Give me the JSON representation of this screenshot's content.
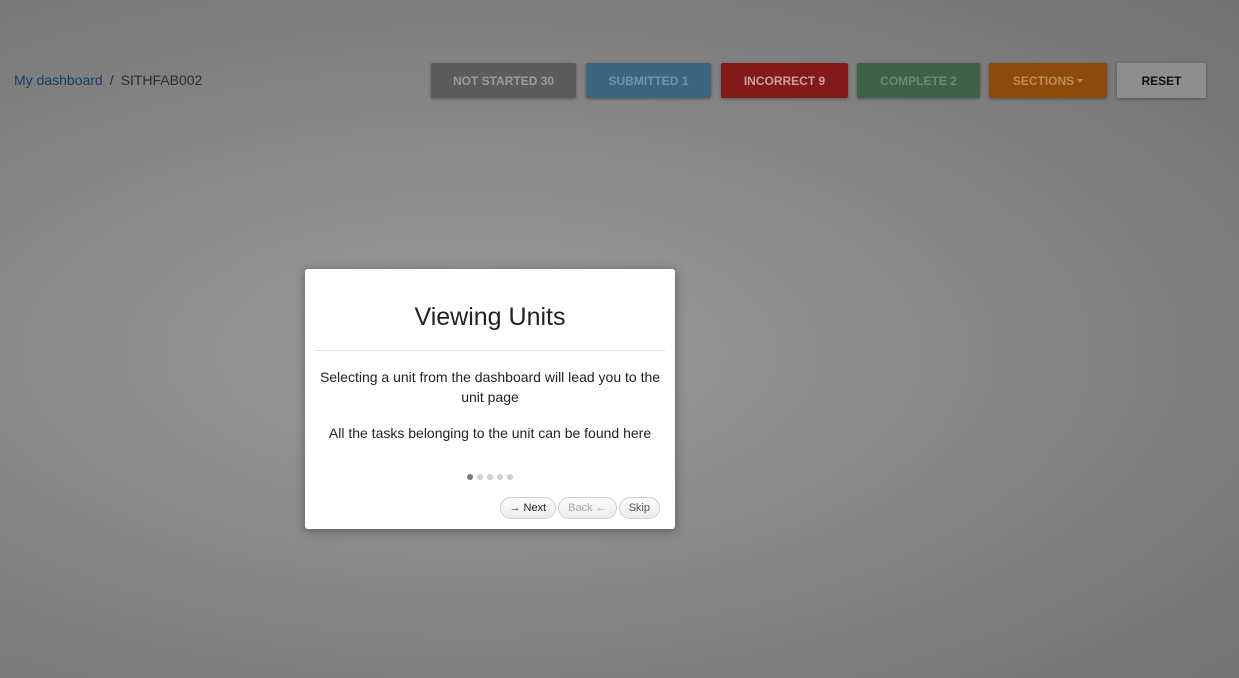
{
  "breadcrumb": {
    "home_label": "My dashboard",
    "separator": "/",
    "current": "SITHFAB002"
  },
  "status_buttons": {
    "not_started": "NOT STARTED 30",
    "submitted": "SUBMITTED 1",
    "incorrect": "INCORRECT 9",
    "complete": "COMPLETE 2",
    "sections": "SECTIONS",
    "reset": "RESET"
  },
  "colors": {
    "not_started": "#5c5c5c",
    "submitted": "#3e6580",
    "incorrect": "#831919",
    "complete": "#3f6148",
    "sections": "#8b4b0b"
  },
  "tour": {
    "title": "Viewing Units",
    "paragraphs": [
      "Selecting a unit from the dashboard will lead you to the unit page",
      "All the tasks belonging to the unit can be found here"
    ],
    "step_current": 1,
    "step_total": 5,
    "next_arrow": "→",
    "next_label": "Next",
    "back_label": "Back",
    "back_arrow": "←",
    "skip_label": "Skip"
  },
  "icons": {
    "sections_caret": "caret-down-icon"
  }
}
